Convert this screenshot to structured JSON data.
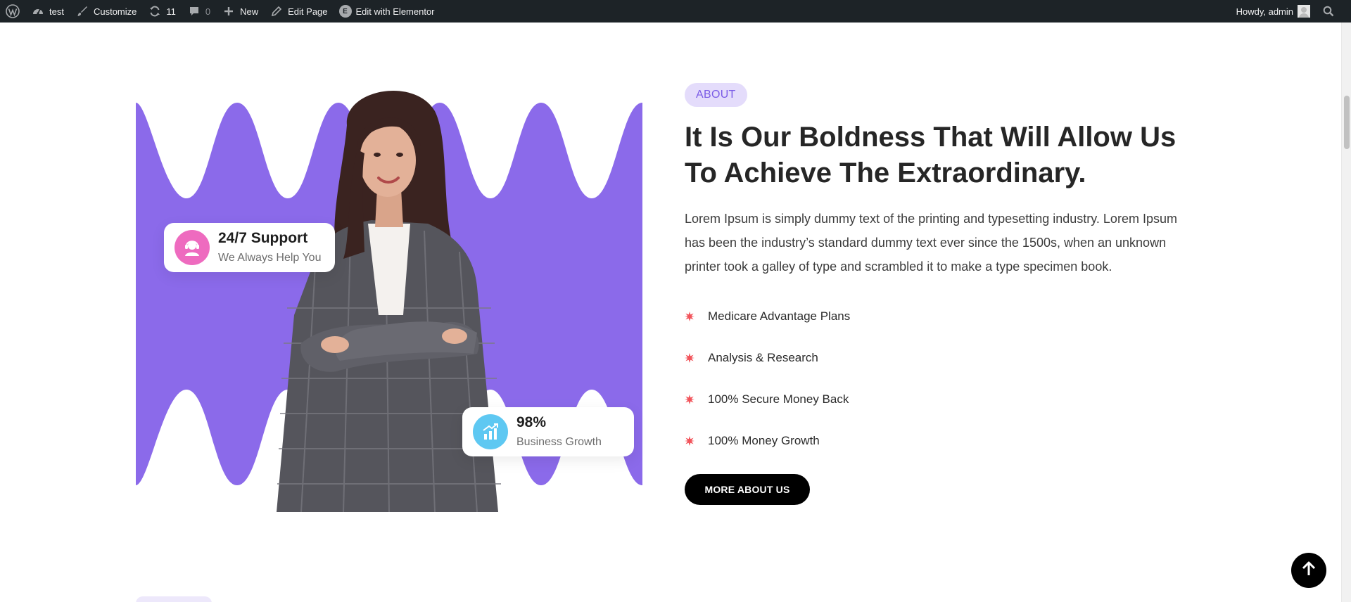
{
  "adminbar": {
    "site_name": "test",
    "customize": "Customize",
    "updates_count": "11",
    "comments_count": "0",
    "new_label": "New",
    "edit_page": "Edit Page",
    "edit_elementor": "Edit with Elementor",
    "elementor_badge": "E",
    "howdy": "Howdy, admin"
  },
  "about": {
    "tag": "ABOUT",
    "heading": "It Is Our Boldness That Will Allow Us To Achieve The Extraordinary.",
    "paragraph": "Lorem Ipsum is simply dummy text of the printing and typesetting industry. Lorem Ipsum has been the industry’s standard dummy text ever since the 1500s, when an unknown printer took a galley of type and scrambled it to make a type specimen book.",
    "features": [
      "Medicare Advantage Plans",
      "Analysis & Research",
      "100% Secure Money Back",
      "100% Money Growth"
    ],
    "button": "MORE ABOUT US"
  },
  "cards": {
    "support_title": "24/7 Support",
    "support_sub": "We Always Help You",
    "growth_title": "98%",
    "growth_sub": "Business Growth"
  },
  "colors": {
    "accent_purple": "#8b6aea",
    "tag_bg": "#e4dcfb",
    "bullet_red": "#f2545b",
    "adminbar_bg": "#1d2327"
  }
}
